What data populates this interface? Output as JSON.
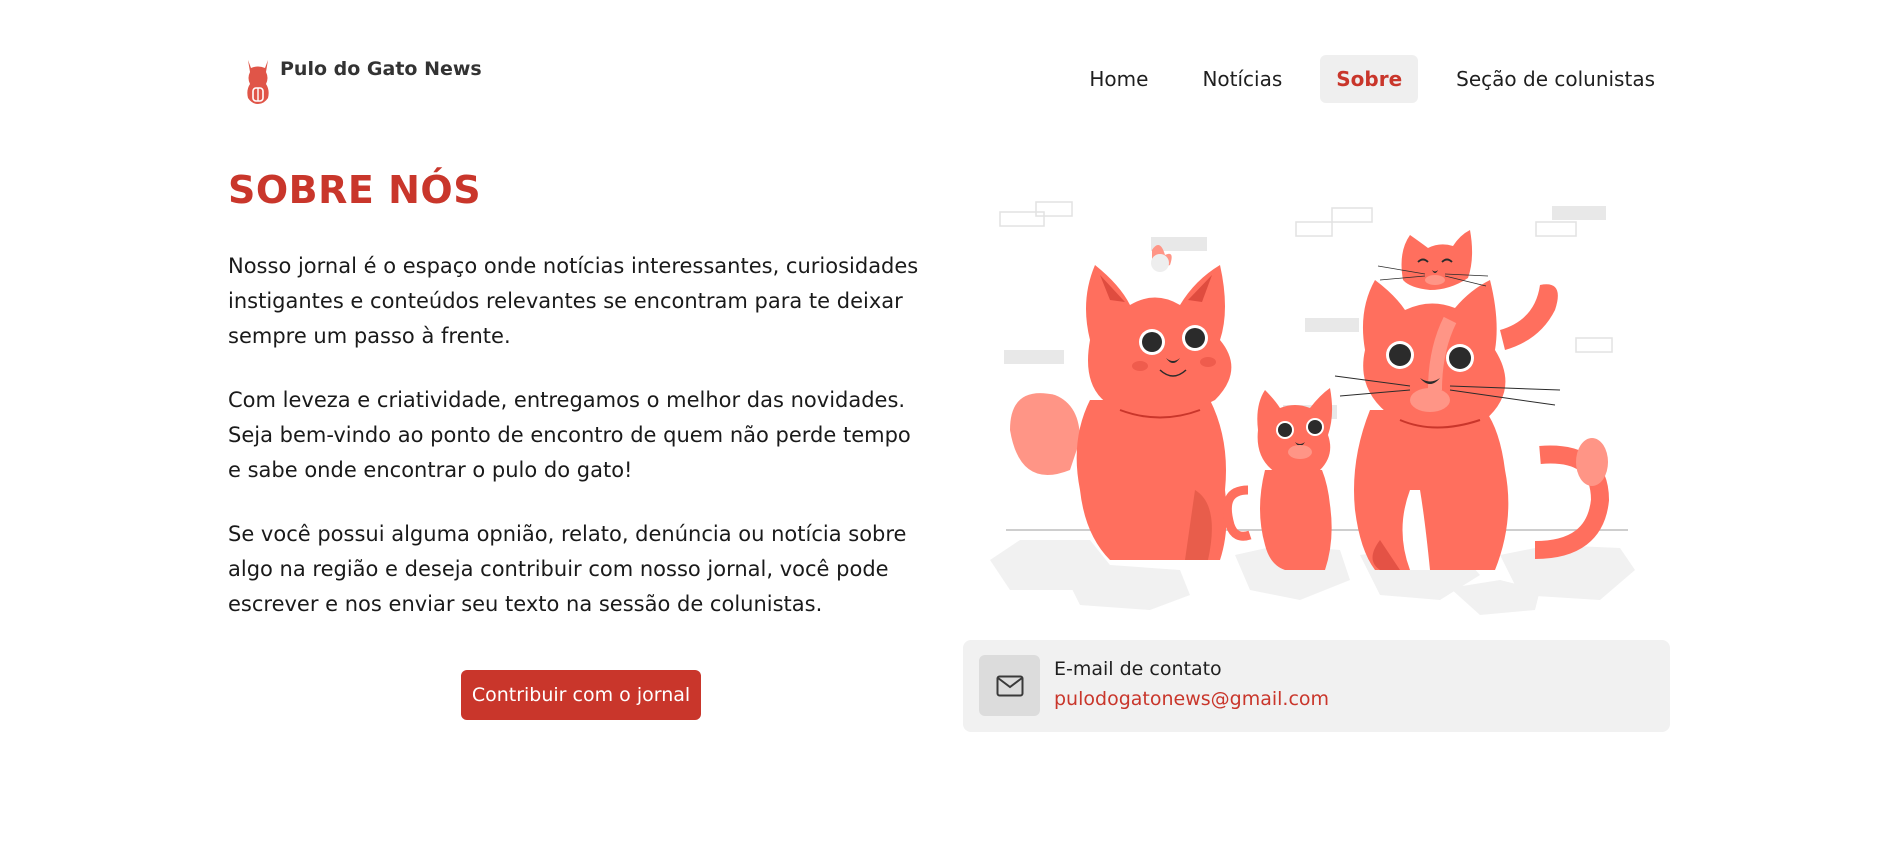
{
  "brand": {
    "name": "Pulo do Gato News",
    "logo_icon": "cat-logo-icon",
    "color": "#c9362b"
  },
  "nav": {
    "items": [
      {
        "label": "Home",
        "active": false
      },
      {
        "label": "Notícias",
        "active": false
      },
      {
        "label": "Sobre",
        "active": true
      },
      {
        "label": "Seção de colunistas",
        "active": false
      }
    ]
  },
  "about": {
    "title": "SOBRE NÓS",
    "paragraphs": [
      "Nosso jornal é o espaço onde notícias interessantes, curiosidades instigantes e conteúdos relevantes se encontram para te deixar sempre um passo à frente.",
      "Com leveza e criatividade, entregamos o melhor das novidades. Seja bem-vindo ao ponto de encontro de quem não perde tempo e sabe onde encontrar o pulo do gato!",
      "Se você possui alguma opnião, relato, denúncia ou notícia sobre algo na região e deseja contribuir com nosso jornal, você pode escrever e nos enviar seu texto na sessão de colunistas."
    ],
    "button_label": "Contribuir com o jornal"
  },
  "illustration": {
    "icon": "cats-family-illustration",
    "primary_color": "#ff6f5e"
  },
  "contact": {
    "label": "E-mail de contato",
    "email": "pulodogatonews@gmail.com",
    "icon": "mail-icon"
  },
  "colors": {
    "accent": "#c9362b",
    "nav_active_bg": "#efefef",
    "card_bg": "#f1f1f1"
  }
}
